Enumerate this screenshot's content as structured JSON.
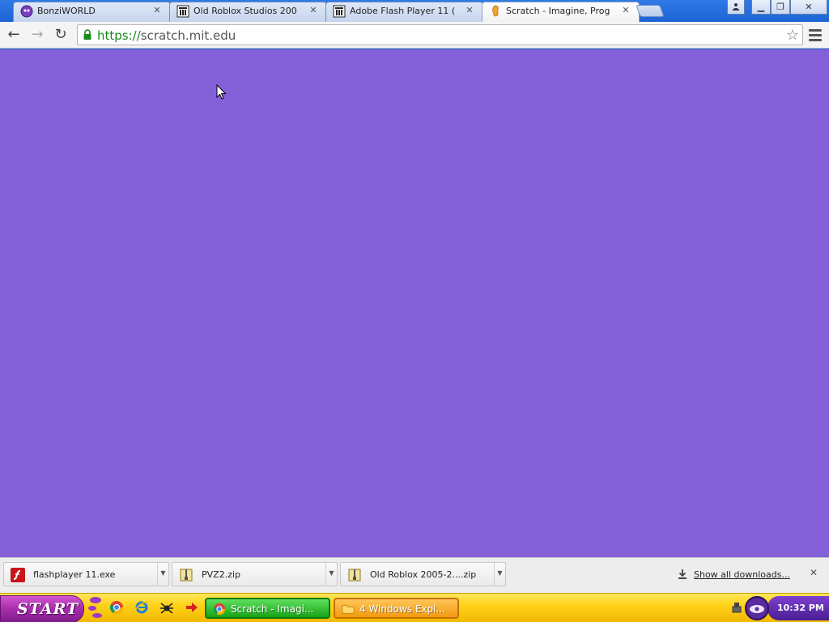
{
  "browser": {
    "tabs": [
      {
        "title": "BonziWORLD",
        "favicon": "bonziworld-icon",
        "active": false
      },
      {
        "title": "Old Roblox Studios 200",
        "favicon": "archive-icon",
        "active": false
      },
      {
        "title": "Adobe Flash Player 11 (",
        "favicon": "archive-icon",
        "active": false
      },
      {
        "title": "Scratch - Imagine, Prog",
        "favicon": "scratch-icon",
        "active": true
      }
    ],
    "address": {
      "scheme": "https://",
      "host": "scratch.mit.edu"
    },
    "page_background": "#835fd8"
  },
  "downloads": {
    "items": [
      {
        "name": "flashplayer 11.exe",
        "icon": "flash-icon"
      },
      {
        "name": "PVZ2.zip",
        "icon": "zip-icon"
      },
      {
        "name": "Old Roblox 2005-2....zip",
        "icon": "zip-icon"
      }
    ],
    "show_all": "Show all downloads..."
  },
  "taskbar": {
    "start_label": "START",
    "tasks": [
      {
        "label": "Scratch - Imagi...",
        "icon": "chrome-icon"
      },
      {
        "label": "4 Windows Expl...",
        "icon": "folder-icon"
      }
    ],
    "clock": "10:32 PM"
  }
}
